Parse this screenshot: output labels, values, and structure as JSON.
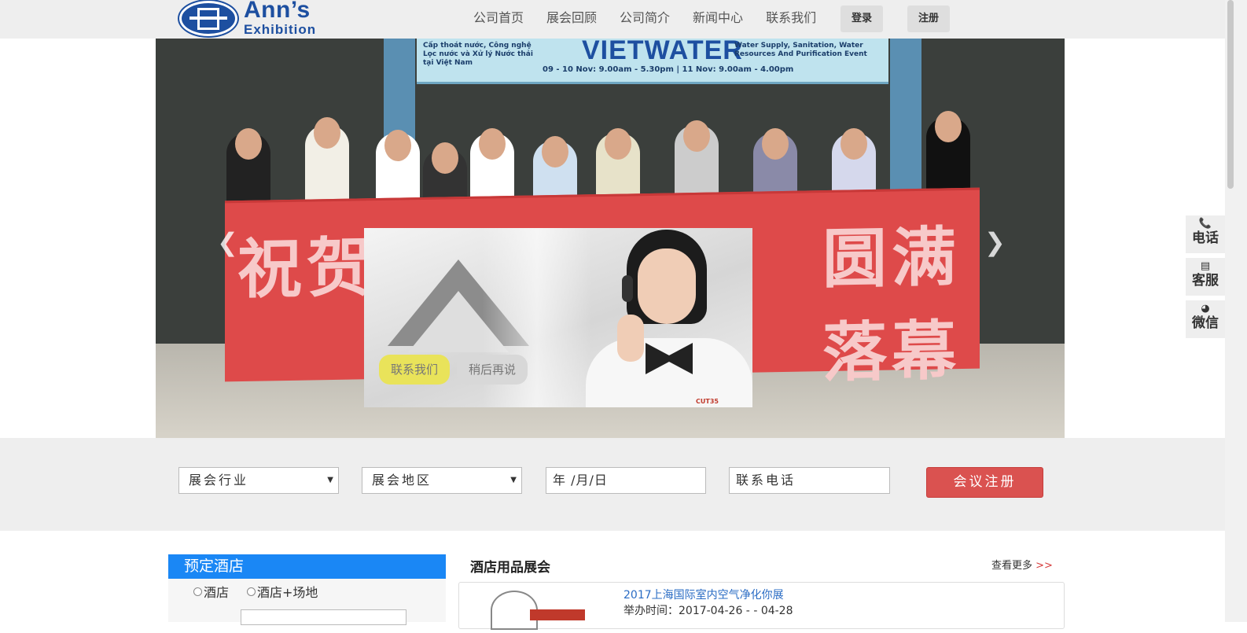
{
  "brand": {
    "name": "Ann’s",
    "sub": "Exhibition",
    "primary_color": "#1d4fa0"
  },
  "nav": {
    "items": [
      "公司首页",
      "展会回顾",
      "公司简介",
      "新闻中心",
      "联系我们"
    ],
    "login_label": "登录",
    "register_label": "注册"
  },
  "banner": {
    "sign_left": "Cấp thoát nước, Công nghệ Lọc nước và Xử lý Nước thải tại Việt Nam",
    "sign_logo": "VIETWATER",
    "sign_right": "Water Supply, Sanitation, Water Resources And Purification Event",
    "sign_date": "09 - 10 Nov: 9.00am - 5.30pm  |  11 Nov: 9.00am - 4.00pm",
    "red_text_left": "祝贺北",
    "red_text_right": "圆满落幕",
    "prev_icon": "chevron-left-icon",
    "next_icon": "chevron-right-icon"
  },
  "popup": {
    "contact_label": "联系我们",
    "later_label": "稍后再说",
    "tag": "CUT35"
  },
  "side_tools": [
    {
      "icon": "phone-icon",
      "glyph": "📞",
      "label": "电话"
    },
    {
      "icon": "service-card-icon",
      "glyph": "▤",
      "label": "客服"
    },
    {
      "icon": "wechat-icon",
      "glyph": "◕",
      "label": "微信"
    }
  ],
  "search": {
    "industry_label": "展会行业",
    "region_label": "展会地区",
    "date_placeholder": "年 /月/日",
    "phone_placeholder": "联系电话",
    "submit_label": "会议注册",
    "submit_color": "#da5250"
  },
  "hotel": {
    "title": "预定酒店",
    "option_hotel": "酒店",
    "option_hotel_venue": "酒店+场地",
    "title_color": "#1a87f5"
  },
  "expo_section": {
    "title": "酒店用品展会",
    "more_label": "查看更多",
    "more_chevron": ">>",
    "items": [
      {
        "name": "2017上海国际室内空气净化你展",
        "date": "举办时间：2017-04-26 - - 04-28"
      }
    ]
  }
}
